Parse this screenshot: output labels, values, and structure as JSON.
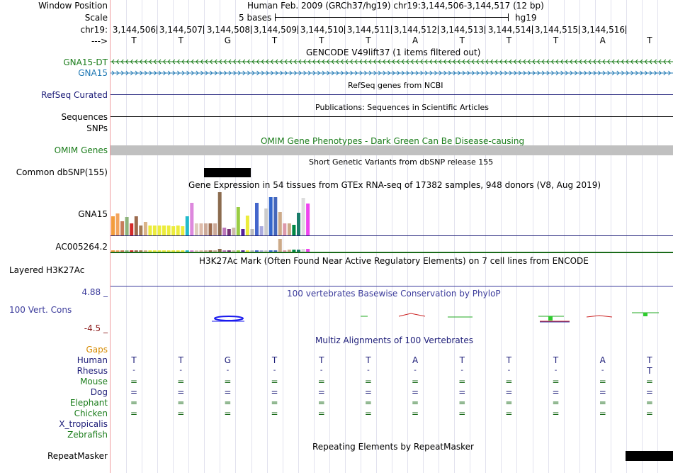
{
  "labels": {
    "window_position": "Window Position",
    "scale": "Scale",
    "chrom": "chr19:",
    "arrow": "--->",
    "gna15_dt": "GNA15-DT",
    "gna15": "GNA15",
    "refseq": "RefSeq Curated",
    "sequences": "Sequences",
    "snps": "SNPs",
    "omim": "OMIM Genes",
    "common_dbsnp": "Common dbSNP(155)",
    "gtex_gna15": "GNA15",
    "gtex_ac": "AC005264.2",
    "h3k27ac": "Layered H3K27Ac",
    "phylop_max": "4.88 _",
    "phylop_label": "100 Vert. Cons",
    "phylop_min": "-4.5 _",
    "gaps": "Gaps",
    "species": [
      "Human",
      "Rhesus",
      "Mouse",
      "Dog",
      "Elephant",
      "Chicken",
      "X_tropicalis",
      "Zebrafish"
    ],
    "repeatmasker": "RepeatMasker"
  },
  "header": {
    "assembly": "Human Feb. 2009 (GRCh37/hg19)   chr19:3,144,506-3,144,517 (12 bp)",
    "scale_text": "5 bases",
    "scale_db": "hg19",
    "positions": [
      "3,144,506",
      "3,144,507",
      "3,144,508",
      "3,144,509",
      "3,144,510",
      "3,144,511",
      "3,144,512",
      "3,144,513",
      "3,144,514",
      "3,144,515",
      "3,144,516"
    ],
    "bases": [
      "T",
      "T",
      "G",
      "T",
      "T",
      "T",
      "A",
      "T",
      "T",
      "T",
      "A",
      "T"
    ]
  },
  "tracks": {
    "gencode_title": "GENCODE V49lift37 (1 items filtered out)",
    "refseq_title": "RefSeq genes from NCBI",
    "publications_title": "Publications: Sequences in Scientific Articles",
    "omim_title": "OMIM Gene Phenotypes - Dark Green Can Be Disease-causing",
    "dbsnp_title": "Short Genetic Variants from dbSNP release 155",
    "gtex_title": "Gene Expression in 54 tissues from GTEx RNA-seq of 17382 samples, 948 donors (V8, Aug 2019)",
    "h3k27ac_title": "H3K27Ac Mark (Often Found Near Active Regulatory Elements) on 7 cell lines from ENCODE",
    "phylop_title": "100 vertebrates Basewise Conservation by PhyloP",
    "multiz_title": "Multiz Alignments of 100 Vertebrates",
    "repeatmasker_title": "Repeating Elements by RepeatMasker"
  },
  "alignment": {
    "Human": [
      "T",
      "T",
      "G",
      "T",
      "T",
      "T",
      "A",
      "T",
      "T",
      "T",
      "A",
      "T"
    ],
    "Rhesus": [
      "-",
      "-",
      "-",
      "-",
      "-",
      "-",
      "-",
      "-",
      "-",
      "-",
      "-",
      "T"
    ],
    "Mouse": [
      "=",
      "=",
      "=",
      "=",
      "=",
      "=",
      "=",
      "=",
      "=",
      "=",
      "=",
      "="
    ],
    "Dog": [
      "=",
      "=",
      "=",
      "=",
      "=",
      "=",
      "=",
      "=",
      "=",
      "=",
      "=",
      "="
    ],
    "Elephant": [
      "=",
      "=",
      "=",
      "=",
      "=",
      "=",
      "=",
      "=",
      "=",
      "=",
      "=",
      "="
    ],
    "Chicken": [
      "=",
      "=",
      "=",
      "=",
      "=",
      "=",
      "=",
      "=",
      "=",
      "=",
      "=",
      "="
    ]
  },
  "colors": {
    "gencode_dt": "#1a7c1a",
    "gencode": "#1f78b4",
    "navy": "#1c1c78",
    "omim": "#1a7c1a",
    "gaps": "#d68a00",
    "phylop": "#3b3b9b",
    "phylop_neg": "#8b1a1a"
  },
  "gtex_gna15_colors": [
    "#f39c3c",
    "#f3a35c",
    "#c77c5a",
    "#8db37c",
    "#d42a2a",
    "#9c6b4e",
    "#a47c58",
    "#d9b388",
    "#ecec3c",
    "#ecec3c",
    "#ecec3c",
    "#ecec3c",
    "#ecec3c",
    "#ecec3c",
    "#ecec3c",
    "#ecec3c",
    "#22bbcc",
    "#dd88dd",
    "#ddccbb",
    "#ddbbaa",
    "#ccaa99",
    "#9c6b4e",
    "#ccaa99",
    "#8b6b4e",
    "#bb77bb",
    "#773377",
    "#ccbbaa",
    "#99cc44",
    "#552299",
    "#ecec3c",
    "#bbbbbb",
    "#4466cc",
    "#aaaadd",
    "#cccccc",
    "#3366cc",
    "#4466bb",
    "#ccaa88",
    "#dd99aa",
    "#ccaa88",
    "#008844",
    "#1a7c6a",
    "#dddddd",
    "#ee44ee"
  ],
  "gtex_gna15_values": [
    27,
    31,
    20,
    26,
    17,
    27,
    14,
    19,
    14,
    14,
    14,
    14,
    14,
    13,
    14,
    13,
    27,
    46,
    17,
    17,
    17,
    17,
    17,
    61,
    11,
    9,
    11,
    40,
    9,
    28,
    9,
    46,
    13,
    38,
    54,
    54,
    33,
    17,
    17,
    15,
    32,
    53,
    45
  ]
}
